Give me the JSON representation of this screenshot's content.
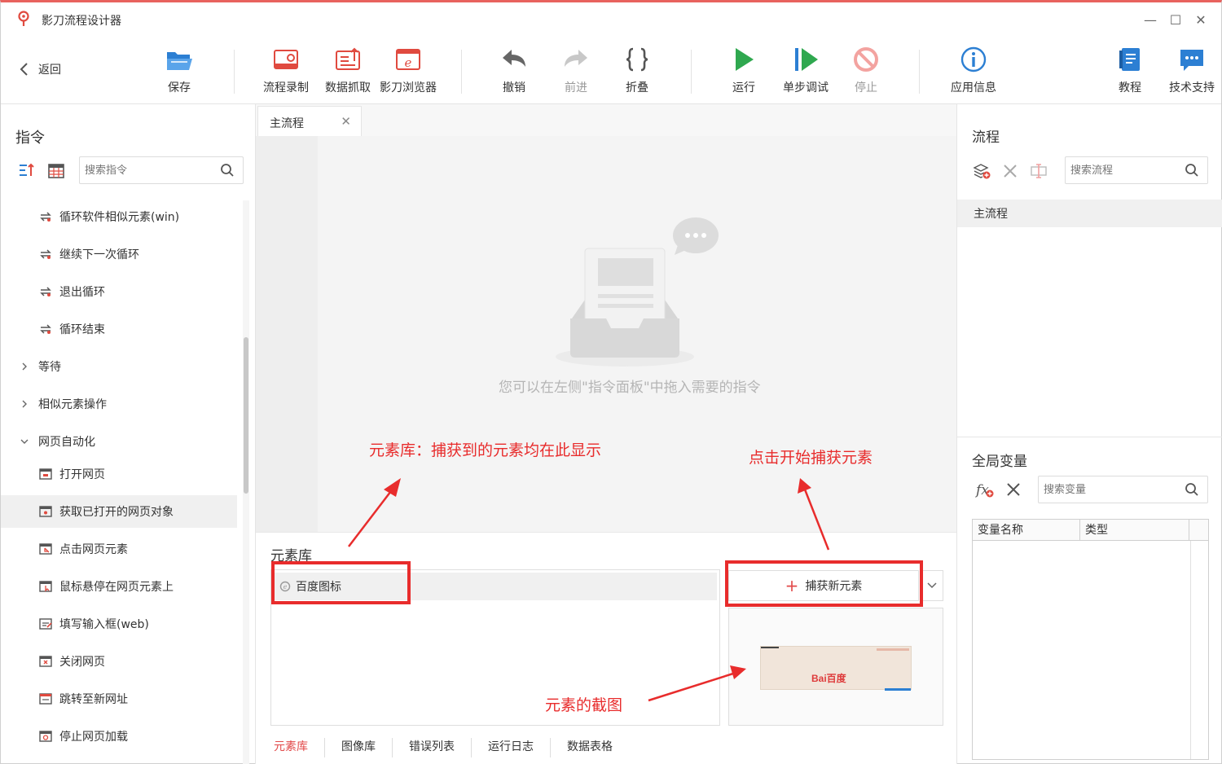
{
  "window": {
    "title": "影刀流程设计器",
    "controls": {
      "minimize": "—",
      "maximize": "☐",
      "close": "✕"
    }
  },
  "toolbar": {
    "back": "返回",
    "save": "保存",
    "record": "流程录制",
    "scrape": "数据抓取",
    "browser": "影刀浏览器",
    "undo": "撤销",
    "redo": "前进",
    "fold": "折叠",
    "run": "运行",
    "step_debug": "单步调试",
    "stop": "停止",
    "app_info": "应用信息",
    "tutorial": "教程",
    "support": "技术支持"
  },
  "left_panel": {
    "title": "指令",
    "search_placeholder": "搜索指令",
    "items": [
      {
        "type": "cmd",
        "label": "循环软件相似元素(win)"
      },
      {
        "type": "cmd",
        "label": "继续下一次循环"
      },
      {
        "type": "cmd",
        "label": "退出循环"
      },
      {
        "type": "cmd",
        "label": "循环结束"
      },
      {
        "type": "group",
        "label": "等待",
        "expanded": false
      },
      {
        "type": "group",
        "label": "相似元素操作",
        "expanded": false
      },
      {
        "type": "group",
        "label": "网页自动化",
        "expanded": true
      },
      {
        "type": "cmd",
        "label": "打开网页"
      },
      {
        "type": "cmd",
        "label": "获取已打开的网页对象",
        "selected": true
      },
      {
        "type": "cmd",
        "label": "点击网页元素"
      },
      {
        "type": "cmd",
        "label": "鼠标悬停在网页元素上"
      },
      {
        "type": "cmd",
        "label": "填写输入框(web)"
      },
      {
        "type": "cmd",
        "label": "关闭网页"
      },
      {
        "type": "cmd",
        "label": "跳转至新网址"
      },
      {
        "type": "cmd",
        "label": "停止网页加载"
      }
    ]
  },
  "editor": {
    "tab_label": "主流程",
    "empty_hint": "您可以在左侧\"指令面板\"中拖入需要的指令"
  },
  "element_library": {
    "title": "元素库",
    "elements": [
      "百度图标"
    ],
    "capture_button": "捕获新元素",
    "preview_logo": "Bai百度",
    "bottom_tabs": [
      "元素库",
      "图像库",
      "错误列表",
      "运行日志",
      "数据表格"
    ]
  },
  "right_panel": {
    "flow_title": "流程",
    "flow_search_placeholder": "搜索流程",
    "flows": [
      "主流程"
    ],
    "vars_title": "全局变量",
    "vars_search_placeholder": "搜索变量",
    "var_columns": [
      "变量名称",
      "类型"
    ]
  },
  "annotations": {
    "library_note": "元素库：捕获到的元素均在此显示",
    "capture_note": "点击开始捕获元素",
    "screenshot_note": "元素的截图"
  },
  "colors": {
    "accent_red": "#e82c2c",
    "run_green": "#2fa84f",
    "toolbar_blue": "#2c7fd3",
    "toolbar_red": "#e04a3f"
  }
}
